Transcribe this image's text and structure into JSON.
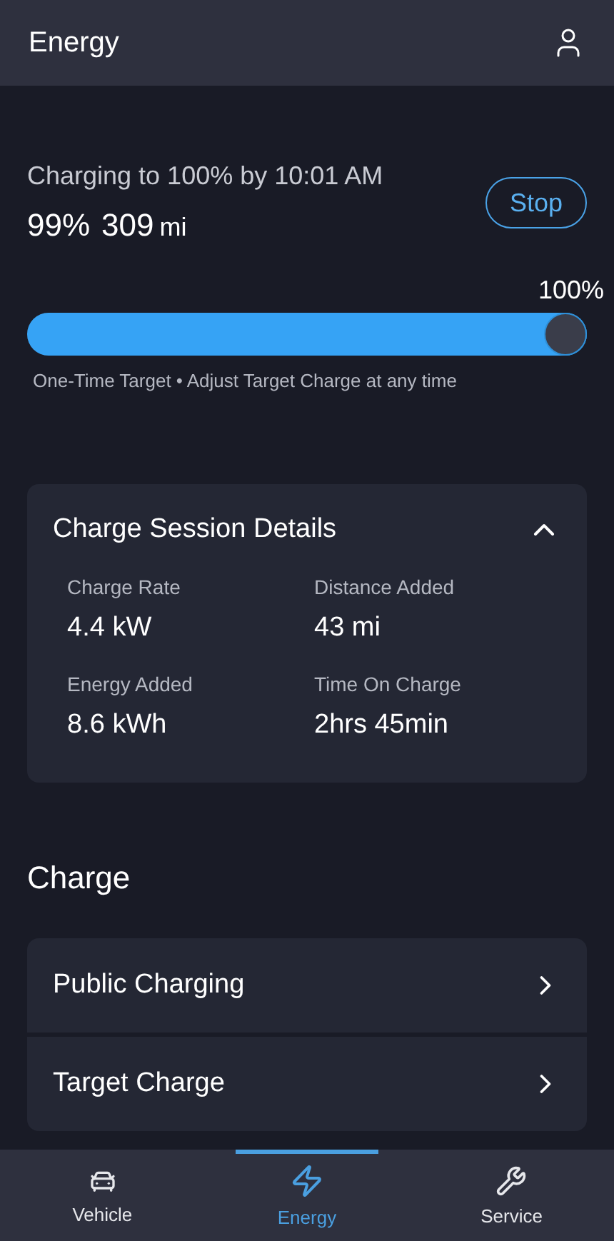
{
  "header": {
    "title": "Energy"
  },
  "status": {
    "headline": "Charging to 100% by 10:01 AM",
    "percent": "99%",
    "range": "309",
    "range_unit": "mi",
    "stop_button": "Stop"
  },
  "target_slider": {
    "level": 1,
    "label": "100%",
    "caption": "One-Time Target • Adjust Target Charge at any time"
  },
  "session": {
    "title": "Charge Session Details",
    "expanded": true,
    "stats": [
      {
        "label": "Charge Rate",
        "value": "4.4 kW"
      },
      {
        "label": "Distance Added",
        "value": "43 mi"
      },
      {
        "label": "Energy Added",
        "value": "8.6 kWh"
      },
      {
        "label": "Time On Charge",
        "value": "2hrs 45min"
      }
    ]
  },
  "charge": {
    "heading": "Charge",
    "items": [
      {
        "label": "Public Charging"
      },
      {
        "label": "Target Charge"
      }
    ]
  },
  "nav": [
    {
      "kind": "vehicle",
      "label": "Vehicle",
      "selected": false
    },
    {
      "kind": "energy",
      "label": "Energy",
      "selected": true
    },
    {
      "kind": "service",
      "label": "Service",
      "selected": false
    }
  ]
}
